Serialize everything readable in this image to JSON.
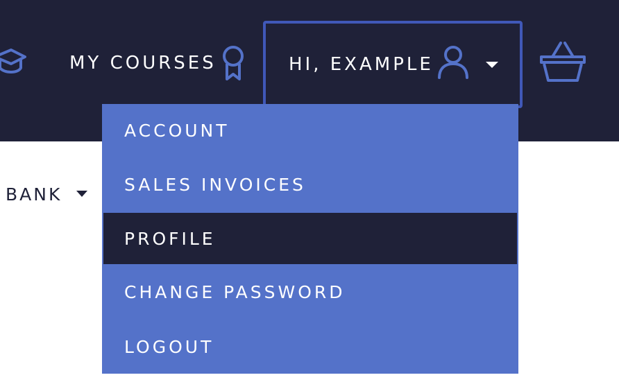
{
  "header": {
    "my_courses_label": "MY COURSES",
    "greeting": "HI, EXAMPLE",
    "icons": [
      "graduation-cap-icon",
      "ribbon-award-icon",
      "user-icon",
      "caret-down-icon",
      "basket-icon"
    ]
  },
  "account_menu": {
    "items": [
      {
        "label": "ACCOUNT",
        "active": false
      },
      {
        "label": "SALES INVOICES",
        "active": false
      },
      {
        "label": "PROFILE",
        "active": true
      },
      {
        "label": "CHANGE PASSWORD",
        "active": false
      },
      {
        "label": "LOGOUT",
        "active": false
      }
    ]
  },
  "content": {
    "bank_label": "BANK"
  },
  "colors": {
    "nav_background": "#1f2138",
    "accent": "#4058b8",
    "dropdown_background": "#5472c9",
    "active_item_background": "#1f2138",
    "text_light": "#ffffff"
  }
}
